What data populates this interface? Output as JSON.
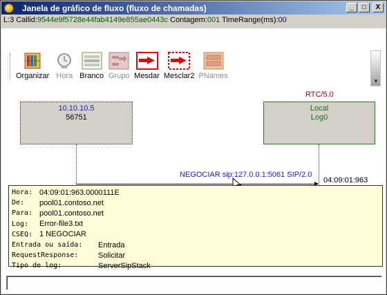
{
  "window": {
    "title": "Janela de gráfico de fluxo (fluxo de chamadas)"
  },
  "controls": {
    "minimize": "_",
    "maximize": "□",
    "close": "X"
  },
  "info": {
    "l_prefix": "L:3 Callid:",
    "callid": "9544e9f5728e44fab4149e855ae0443c",
    "contagem_label": " Contagem:",
    "contagem": "001",
    "time_label": " TimeRange(ms):",
    "time": "00"
  },
  "toolbar": {
    "organizar": "Organizar",
    "hora": "Hora",
    "branco": "Branco",
    "grupo": "Grupo",
    "mesdar": "Mesdar",
    "mesclar2": "Mesclar2",
    "pnames": "PNames"
  },
  "diagram": {
    "rtc_label": "RTC/5.0",
    "node_a_ip": "10.10.10.5",
    "node_a_port": "56751",
    "node_b_line1": "Local",
    "node_b_line2": "Log0",
    "message": "NEGOCIAR sip:127.0.0.1:5061 SIP/2.0",
    "message_time": "04:09:01:963"
  },
  "detail": {
    "rows": [
      {
        "key": "Hora:",
        "value": "04:09:01:963.0000111E"
      },
      {
        "key": "De:",
        "value": "pool01.contoso.net"
      },
      {
        "key": "Para:",
        "value": "pool01.contoso.net"
      },
      {
        "key": "Log:",
        "value": "Error-file3.txt"
      },
      {
        "key": "CSEQ:",
        "value": "1 NEGOCIAR"
      },
      {
        "key": "Entrada ou saída:",
        "value": "Entrada"
      },
      {
        "key": "RequestResponse:",
        "value": "Solicitar"
      },
      {
        "key": "Tipo de log:",
        "value": "ServerSipStack"
      }
    ]
  },
  "status": {
    "text": ""
  },
  "icons": [
    "app-icon",
    "organizar-icon",
    "clock-icon",
    "branco-icon",
    "grupo-icon",
    "mesdar-icon",
    "mesclar2-icon",
    "pnames-icon",
    "cursor-icon"
  ],
  "colors": {
    "title_gradient_start": "#0a246a",
    "callid_green": "#006400",
    "ip_blue": "#2020c0",
    "rtc_red": "#a00000",
    "detail_bg": "#fffcd8"
  }
}
